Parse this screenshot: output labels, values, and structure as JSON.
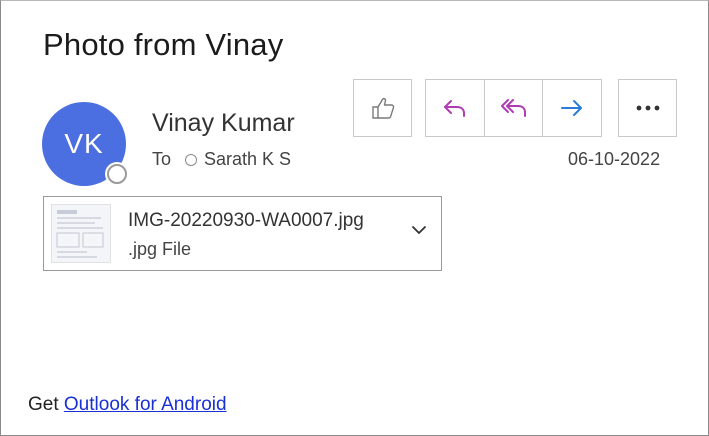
{
  "email": {
    "subject": "Photo from Vinay",
    "sender": {
      "initials": "VK",
      "name": "Vinay Kumar",
      "avatar_color": "#4b6fe0"
    },
    "to_label": "To",
    "recipient": "Sarath  K S",
    "date": "06-10-2022"
  },
  "actions": {
    "like_icon": "thumbs-up-icon",
    "reply_icon": "reply-icon",
    "reply_all_icon": "reply-all-icon",
    "forward_icon": "forward-icon",
    "more_icon": "more-options-icon",
    "accent_color": "#b03cb3",
    "forward_color": "#2b7bd6"
  },
  "attachment": {
    "file_name": "IMG-20220930-WA0007.jpg",
    "file_type": ".jpg File",
    "chevron_icon": "chevron-down-icon"
  },
  "footer": {
    "prefix": "Get",
    "link_text": "Outlook for Android",
    "link_color": "#1a2fd6"
  }
}
